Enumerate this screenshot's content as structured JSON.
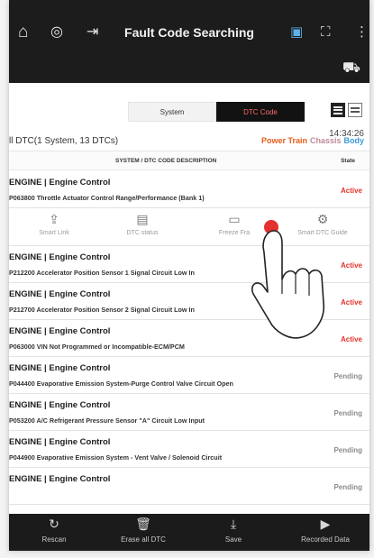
{
  "header": {
    "title": "Fault Code Searching",
    "icons": [
      "home-icon",
      "vci-icon",
      "exit-icon",
      "report-icon",
      "screenshot-icon",
      "more-icon"
    ]
  },
  "tabs": {
    "system": "System",
    "dtc": "DTC Code"
  },
  "time": "14:34:26",
  "summary": "ll DTC(1 System, 13 DTCs)",
  "filters": [
    {
      "label": "Power Train",
      "color": "#e85c1a"
    },
    {
      "label": "Chassis",
      "color": "#c08a9a"
    },
    {
      "label": "Body",
      "color": "#3a98d8"
    }
  ],
  "columns": {
    "desc": "SYSTEM / DTC CODE DESCRIPTION",
    "state": "State"
  },
  "colors": {
    "active": "#e5322b",
    "pending": "#8c8c8c"
  },
  "dtcs": [
    {
      "system": "ENGINE | Engine Control",
      "code": "P063800 Throttle Actuator Control Range/Performance (Bank 1)",
      "state": "Active"
    },
    {
      "system": "ENGINE | Engine Control",
      "code": "P212200 Accelerator Position Sensor 1 Signal Circuit Low In",
      "state": "Active"
    },
    {
      "system": "ENGINE | Engine Control",
      "code": "P212700 Accelerator Position Sensor 2 Signal Circuit Low In",
      "state": "Active"
    },
    {
      "system": "ENGINE | Engine Control",
      "code": "P063000 VIN Not Programmed or Incompatible-ECM/PCM",
      "state": "Active"
    },
    {
      "system": "ENGINE | Engine Control",
      "code": "P044400 Evaporative Emission System-Purge Control Valve Circuit Open",
      "state": "Pending"
    },
    {
      "system": "ENGINE | Engine Control",
      "code": "P053200 A/C Refrigerant Pressure Sensor \"A\" Circuit Low Input",
      "state": "Pending"
    },
    {
      "system": "ENGINE | Engine Control",
      "code": "P044900 Evaporative Emission System - Vent Valve / Solenoid Circuit",
      "state": "Pending"
    },
    {
      "system": "ENGINE | Engine Control",
      "code": "",
      "state": "Pending"
    }
  ],
  "row_actions": [
    {
      "label": "Smart Link",
      "icon": "share-icon"
    },
    {
      "label": "DTC status",
      "icon": "dtc-status-icon"
    },
    {
      "label": "Freeze Fra",
      "icon": "freeze-frame-icon"
    },
    {
      "label": "Smart DTC Guide",
      "icon": "smart-guide-icon"
    }
  ],
  "bottom": [
    {
      "label": "Rescan",
      "icon": "rescan-icon"
    },
    {
      "label": "Erase all DTC",
      "icon": "trash-icon"
    },
    {
      "label": "Save",
      "icon": "save-icon"
    },
    {
      "label": "Recorded Data",
      "icon": "recorded-data-icon"
    }
  ]
}
